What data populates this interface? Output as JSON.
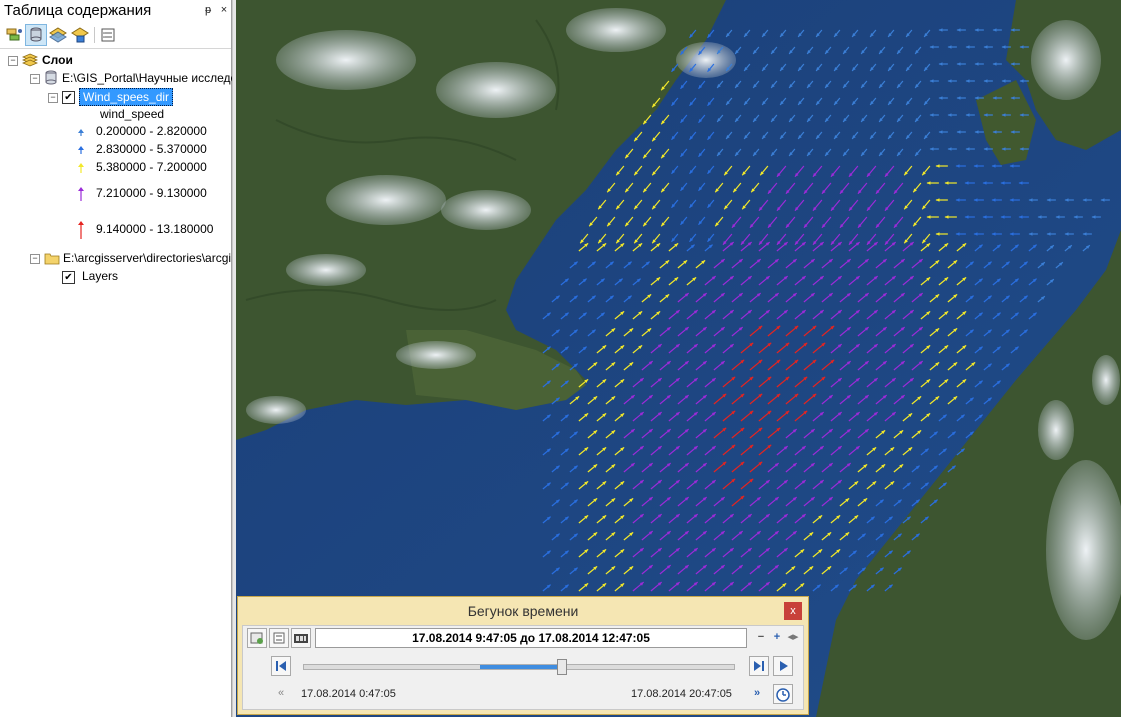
{
  "toc": {
    "title": "Таблица содержания",
    "pin_glyph": "ᵽ",
    "close_glyph": "×",
    "toolbar": [
      {
        "name": "list-by-drawing-order-icon"
      },
      {
        "name": "list-by-source-icon"
      },
      {
        "name": "list-by-visibility-icon"
      },
      {
        "name": "list-by-selection-icon"
      },
      {
        "name": "options-icon"
      }
    ],
    "root_label": "Слои",
    "source1": "E:\\GIS_Portal\\Научные исследо",
    "layer_name": "Wind_spees_dir",
    "field_name": "wind_speed",
    "legend": [
      {
        "label": "0.200000 - 2.820000",
        "color": "#3b7fd6"
      },
      {
        "label": "2.830000 - 5.370000",
        "color": "#2a6fe0"
      },
      {
        "label": "5.380000 - 7.200000",
        "color": "#f2e82a"
      },
      {
        "label": "7.210000 - 9.130000",
        "color": "#9b2bd8"
      },
      {
        "label": "9.140000 - 13.180000",
        "color": "#e52420"
      }
    ],
    "source2": "E:\\arcgisserver\\directories\\arcgi",
    "source2_layer": "Layers"
  },
  "slider": {
    "title": "Бегунок времени",
    "close": "x",
    "range_text": "17.08.2014 9:47:05 до 17.08.2014 12:47:05",
    "start_label": "17.08.2014 0:47:05",
    "end_label": "17.08.2014 20:47:05",
    "position_fraction": 0.6,
    "window_start_fraction": 0.41
  },
  "colors": {
    "sea": "#1d4680",
    "land": "#3a4f2c",
    "snow": "#dfe5ea",
    "slider_bg": "#f5e6b3",
    "highlight": "#3399ff"
  }
}
